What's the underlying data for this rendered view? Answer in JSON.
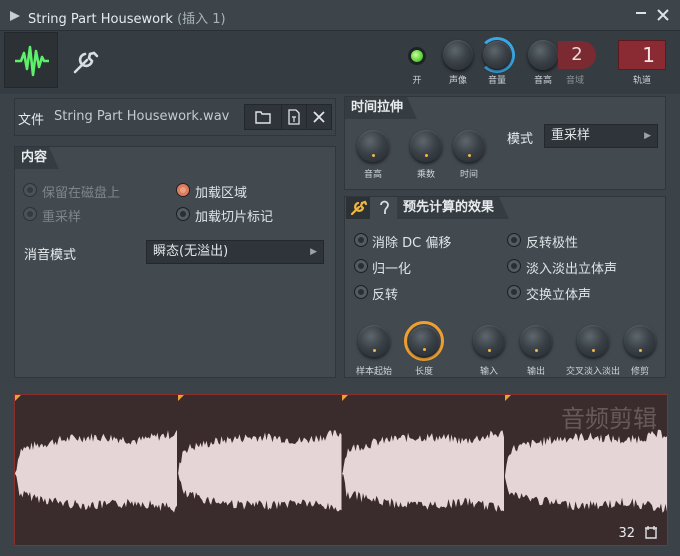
{
  "window": {
    "title": "String Part Housework",
    "subtitle": "(插入 1)",
    "minimize_icon": "minimize-icon",
    "close_icon": "close-icon"
  },
  "toolbar": {
    "tabs": [
      {
        "name": "waveform",
        "icon": "waveform-icon",
        "active": true
      },
      {
        "name": "settings",
        "icon": "wrench-icon",
        "active": false
      }
    ],
    "knobs": [
      {
        "label": "开",
        "kind": "led"
      },
      {
        "label": "声像"
      },
      {
        "label": "音量"
      },
      {
        "label": "音高"
      }
    ],
    "pitch_range": {
      "value": "2",
      "label": "音域"
    },
    "track": {
      "value": "1",
      "label": "轨道"
    }
  },
  "file": {
    "label": "文件",
    "name": "String Part Housework.wav"
  },
  "content": {
    "header": "内容",
    "options_left": [
      {
        "label": "保留在磁盘上",
        "checked": false,
        "enabled": false
      },
      {
        "label": "重采样",
        "checked": false,
        "enabled": false
      }
    ],
    "options_right": [
      {
        "label": "加载区域",
        "checked": true,
        "enabled": true
      },
      {
        "label": "加载切片标记",
        "checked": false,
        "enabled": true
      }
    ],
    "declick_label": "消音模式",
    "declick_value": "瞬态(无溢出)"
  },
  "time_stretch": {
    "header": "时间拉伸",
    "knobs": [
      "音高",
      "乘数",
      "时间"
    ],
    "mode_label": "模式",
    "mode_value": "重采样"
  },
  "precomputed": {
    "header": "预先计算的效果",
    "options_left": [
      "消除 DC 偏移",
      "归一化",
      "反转"
    ],
    "options_right": [
      "反转极性",
      "淡入淡出立体声",
      "交换立体声"
    ],
    "knobs": [
      "样本起始",
      "长度",
      "输入",
      "输出",
      "交叉淡入淡出",
      "修剪"
    ]
  },
  "waveform": {
    "watermark": "音频剪辑",
    "slice_count": "32"
  }
}
